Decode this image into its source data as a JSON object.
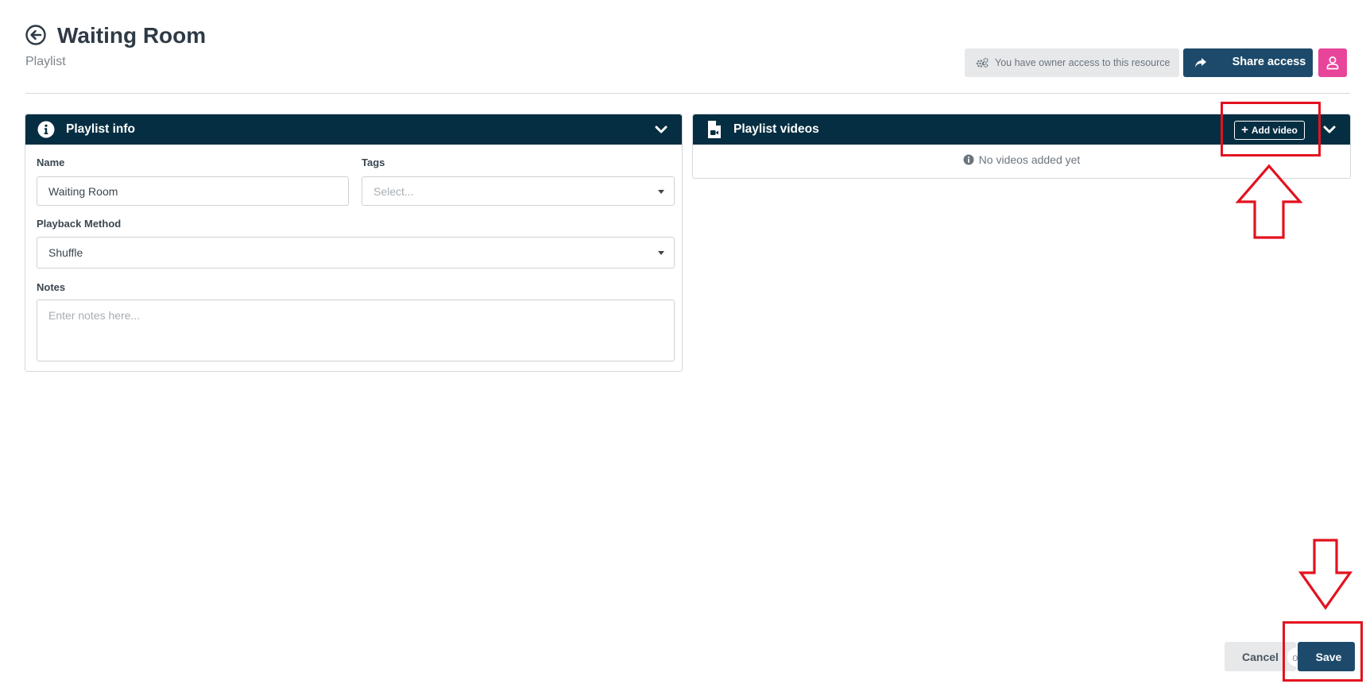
{
  "header": {
    "title": "Waiting Room",
    "subtitle": "Playlist",
    "owner_access_text": "You have owner access to this resource",
    "share_access_label": "Share access"
  },
  "playlist_info": {
    "heading": "Playlist info",
    "name_label": "Name",
    "name_value": "Waiting Room",
    "tags_label": "Tags",
    "tags_placeholder": "Select...",
    "playback_label": "Playback Method",
    "playback_value": "Shuffle",
    "notes_label": "Notes",
    "notes_placeholder": "Enter notes here..."
  },
  "playlist_videos": {
    "heading": "Playlist videos",
    "add_video_label": "Add video",
    "empty_message": "No videos added yet"
  },
  "footer": {
    "cancel_label": "Cancel",
    "or_label": "or",
    "save_label": "Save"
  },
  "colors": {
    "panel_header": "#062e42",
    "primary_button": "#1d4a6a",
    "user_button": "#e8449a",
    "annotation": "#e3121f"
  },
  "icons": {
    "back": "arrow-circle-left-icon",
    "owner": "gears-icon",
    "share": "share-arrow-icon",
    "user": "user-icon",
    "info": "info-circle-icon",
    "video_file": "file-video-icon",
    "chevron": "chevron-down-icon"
  }
}
